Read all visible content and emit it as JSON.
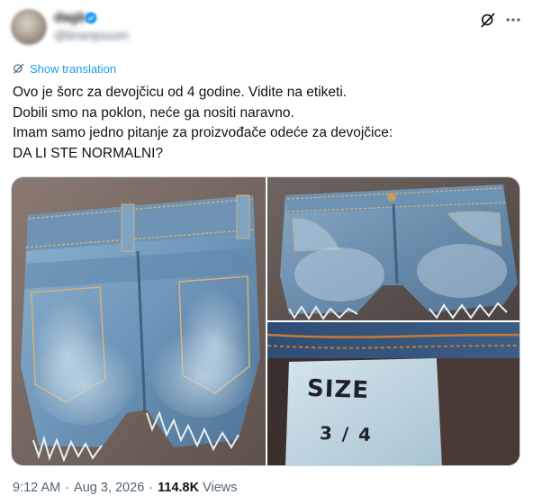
{
  "author": {
    "name": "dagb",
    "handle": "@brwnjouum",
    "verified": true
  },
  "header": {
    "grok_icon": "grok-icon",
    "more_icon": "more-horizontal-icon"
  },
  "translation": {
    "label": "Show translation",
    "icon": "translate-icon"
  },
  "post": {
    "lines": [
      "Ovo je šorc za devojčicu od 4 godine. Vidite na etiketi.",
      "Dobili smo na poklon, neće ga nositi naravno.",
      "Imam samo jedno pitanje za proizvođače odeće za devojčice:",
      "DA LI STE NORMALNI?"
    ]
  },
  "media": {
    "photos": [
      {
        "subject": "denim-shorts-back"
      },
      {
        "subject": "denim-shorts-front"
      },
      {
        "subject": "size-label",
        "label_text": [
          "SIZE",
          "3 / 4"
        ]
      }
    ]
  },
  "meta": {
    "time": "9:12 AM",
    "date": "Aug 3, 2026",
    "views_count": "114.8K",
    "views_label": "Views",
    "separator": "·"
  }
}
